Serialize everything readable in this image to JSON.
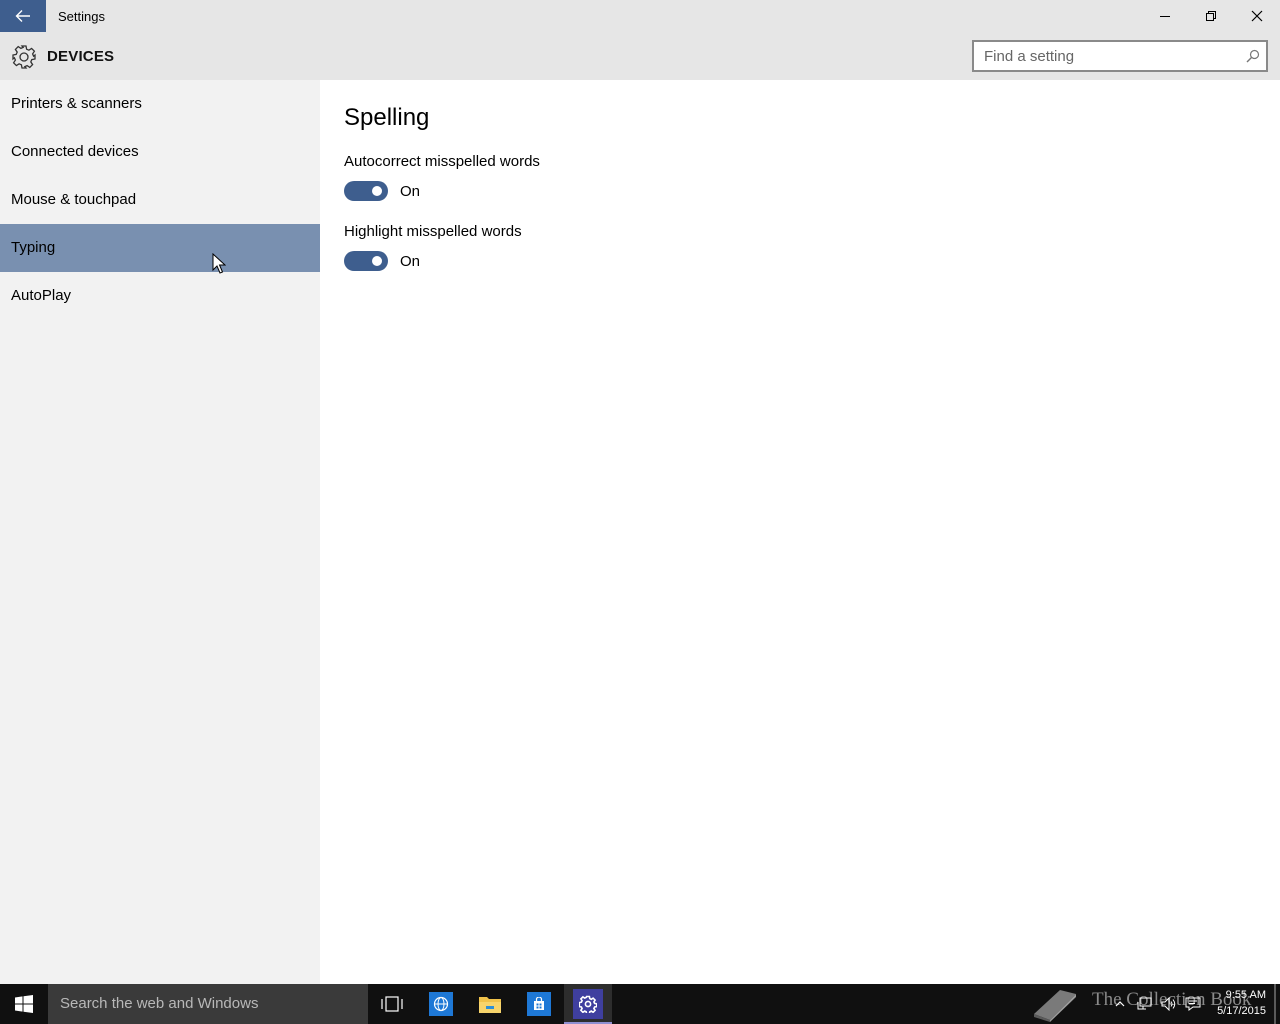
{
  "window": {
    "title": "Settings"
  },
  "header": {
    "section_title": "DEVICES",
    "search_placeholder": "Find a setting"
  },
  "sidebar": {
    "items": [
      {
        "label": "Printers & scanners",
        "selected": false
      },
      {
        "label": "Connected devices",
        "selected": false
      },
      {
        "label": "Mouse & touchpad",
        "selected": false
      },
      {
        "label": "Typing",
        "selected": true
      },
      {
        "label": "AutoPlay",
        "selected": false
      }
    ]
  },
  "content": {
    "title": "Spelling",
    "settings": [
      {
        "label": "Autocorrect misspelled words",
        "state": "On"
      },
      {
        "label": "Highlight misspelled words",
        "state": "On"
      }
    ]
  },
  "taskbar": {
    "search_placeholder": "Search the web and Windows",
    "watermark": "The Collection Book",
    "time": "9:55 AM",
    "date": "5/17/2015"
  },
  "colors": {
    "accent": "#3e5e8e",
    "selected_nav": "#7990b0",
    "header_bg": "#e6e6e6",
    "sidebar_bg": "#f2f2f2",
    "taskbar_bg": "#101010"
  },
  "icons": {
    "back": "back-arrow-icon",
    "header": "gear-icon",
    "search": "search-icon",
    "window_controls": [
      "minimize-icon",
      "restore-icon",
      "close-icon"
    ],
    "taskbar": [
      "windows-logo-icon",
      "task-view-icon",
      "internet-explorer-icon",
      "file-explorer-icon",
      "store-icon",
      "settings-icon"
    ],
    "tray": [
      "chevron-up-icon",
      "network-icon",
      "volume-icon",
      "action-center-icon"
    ]
  }
}
